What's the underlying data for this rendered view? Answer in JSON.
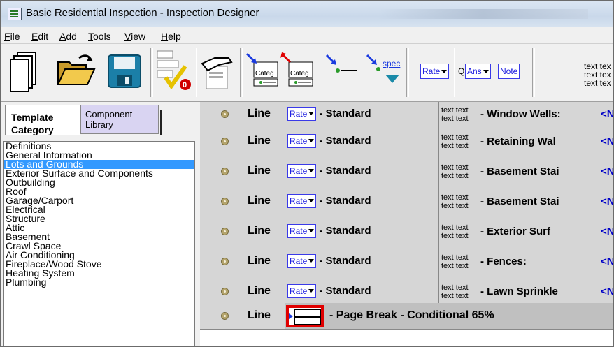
{
  "window": {
    "title": "Basic Residential Inspection - Inspection Designer"
  },
  "menu": [
    {
      "label": "File",
      "u": "F"
    },
    {
      "label": "Edit",
      "u": "E"
    },
    {
      "label": "Add",
      "u": "A"
    },
    {
      "label": "Tools",
      "u": "T"
    },
    {
      "label": "View",
      "u": "V"
    },
    {
      "label": "Help",
      "u": "H"
    }
  ],
  "toolbar": {
    "categ1": "Categ",
    "categ2": "Categ",
    "spec": "spec",
    "rate": "Rate",
    "q": "Q",
    "ans": "Ans",
    "note": "Note",
    "text_lines": [
      "text tex",
      "text tex",
      "text tex"
    ]
  },
  "tabs": {
    "template_category": [
      "Template",
      "Category"
    ],
    "component_library": [
      "Component",
      "Library"
    ]
  },
  "categories": [
    "Definitions",
    "General Information",
    "Lots and Grounds",
    "Exterior Surface and Components",
    "Outbuilding",
    "Roof",
    "Garage/Carport",
    "Electrical",
    "Structure",
    "Attic",
    "Basement",
    "Crawl Space",
    "Air Conditioning",
    "Fireplace/Wood Stove",
    "Heating System",
    "Plumbing"
  ],
  "selected_category": "Lots and Grounds",
  "rows": [
    {
      "type": "Line",
      "rate": "Rate",
      "kind": "- Standard",
      "text": "text text",
      "text2": "text text",
      "label": "- Window Wells:",
      "last": "<N"
    },
    {
      "type": "Line",
      "rate": "Rate",
      "kind": "- Standard",
      "text": "text text",
      "text2": "text text",
      "label": "- Retaining Wal",
      "last": "<N"
    },
    {
      "type": "Line",
      "rate": "Rate",
      "kind": "- Standard",
      "text": "text text",
      "text2": "text text",
      "label": "- Basement Stai",
      "last": "<N"
    },
    {
      "type": "Line",
      "rate": "Rate",
      "kind": "- Standard",
      "text": "text text",
      "text2": "text text",
      "label": "- Basement Stai",
      "last": "<N"
    },
    {
      "type": "Line",
      "rate": "Rate",
      "kind": "- Standard",
      "text": "text text",
      "text2": "text text",
      "label": "- Exterior Surf",
      "last": "<N"
    },
    {
      "type": "Line",
      "rate": "Rate",
      "kind": "- Standard",
      "text": "text text",
      "text2": "text text",
      "label": "- Fences:",
      "last": "<N"
    },
    {
      "type": "Line",
      "rate": "Rate",
      "kind": "- Standard",
      "text": "text text",
      "text2": "text text",
      "label": "- Lawn Sprinkle",
      "last": "<N"
    }
  ],
  "page_break_row": {
    "type": "Line",
    "label": "- Page Break - Conditional 65%"
  },
  "colors": {
    "highlight": "#e00000",
    "selection": "#3399ff",
    "rate_blue": "#2020e0"
  }
}
